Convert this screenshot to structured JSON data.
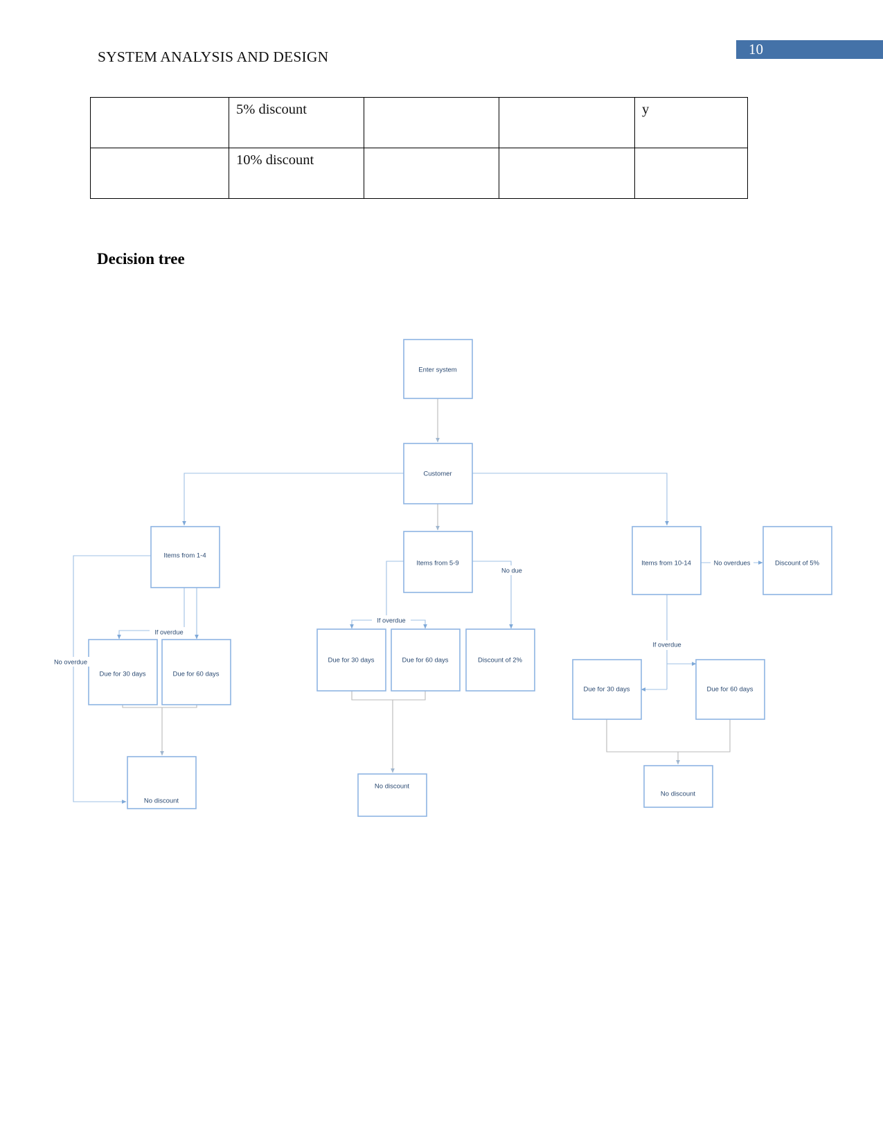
{
  "page": {
    "number": "10",
    "header_title": "SYSTEM ANALYSIS AND DESIGN",
    "badge_color": "#4472a8"
  },
  "table": {
    "rows": [
      {
        "cells": [
          "",
          "5% discount",
          "",
          "",
          "y"
        ]
      },
      {
        "cells": [
          "",
          "10% discount",
          "",
          "",
          ""
        ]
      }
    ]
  },
  "section": {
    "heading": "Decision tree"
  },
  "diagram": {
    "title": "Decision tree",
    "node_border_color": "#8eb4e3",
    "node_text_color": "#2b4a72",
    "connector_color": "#9fc0e4",
    "nodes": [
      {
        "id": "enter-system",
        "label": "Enter system"
      },
      {
        "id": "customer",
        "label": "Customer"
      },
      {
        "id": "items-1-4",
        "label": "Items from 1-4"
      },
      {
        "id": "items-5-9",
        "label": "Items from 5-9"
      },
      {
        "id": "items-10-14",
        "label": "Items from 10-14"
      },
      {
        "id": "discount-5",
        "label": "Discount of 5%"
      },
      {
        "id": "left-due-30",
        "label": "Due for 30 days"
      },
      {
        "id": "left-due-60",
        "label": "Due for 60 days"
      },
      {
        "id": "left-no-discount",
        "label": "No discount"
      },
      {
        "id": "mid-due-30",
        "label": "Due for 30 days"
      },
      {
        "id": "mid-due-60",
        "label": "Due for 60 days"
      },
      {
        "id": "discount-2",
        "label": "Discount of 2%"
      },
      {
        "id": "mid-no-discount",
        "label": "No discount"
      },
      {
        "id": "right-due-30",
        "label": "Due for 30 days"
      },
      {
        "id": "right-due-60",
        "label": "Due for 60 days"
      },
      {
        "id": "right-no-discount",
        "label": "No discount"
      }
    ],
    "edge_labels": [
      {
        "id": "left-no-overdue",
        "label": "No overdue"
      },
      {
        "id": "left-if-overdue",
        "label": "If overdue"
      },
      {
        "id": "mid-if-overdue",
        "label": "If overdue"
      },
      {
        "id": "mid-no-due",
        "label": "No due"
      },
      {
        "id": "right-no-overdues",
        "label": "No overdues"
      },
      {
        "id": "right-if-overdue",
        "label": "If overdue"
      }
    ]
  }
}
